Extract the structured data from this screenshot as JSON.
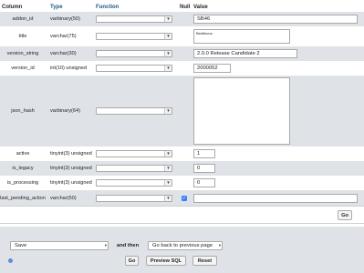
{
  "headers": {
    "column": "Column",
    "type": "Type",
    "function": "Function",
    "null": "Null",
    "value": "Value"
  },
  "rows": [
    {
      "name": "addon_id",
      "type": "varbinary(50)",
      "value": "SB46"
    },
    {
      "name": "title",
      "type": "varchar(75)",
      "value": "Bestfocus"
    },
    {
      "name": "version_string",
      "type": "varchar(30)",
      "value": "2.0.0 Release Candidate 2"
    },
    {
      "name": "version_id",
      "type": "int(10) unsigned",
      "value": "2000052"
    },
    {
      "name": "json_hash",
      "type": "varbinary(64)",
      "value": ""
    },
    {
      "name": "active",
      "type": "tinyint(3) unsigned",
      "value": "1"
    },
    {
      "name": "is_legacy",
      "type": "tinyint(3) unsigned",
      "value": "0"
    },
    {
      "name": "is_processing",
      "type": "tinyint(3) unsigned",
      "value": "0"
    },
    {
      "name": "last_pending_action",
      "type": "varchar(50)",
      "value": "",
      "null_checked": true
    }
  ],
  "go_button": "Go",
  "footer": {
    "action_select": "Save",
    "and_then": "and then",
    "after_select": "Go back to previous page",
    "go_label": "Go",
    "preview_label": "Preview SQL",
    "reset_label": "Reset"
  },
  "colors": {
    "header_blue": "#235a81",
    "row_shade": "#dfe3e8"
  }
}
